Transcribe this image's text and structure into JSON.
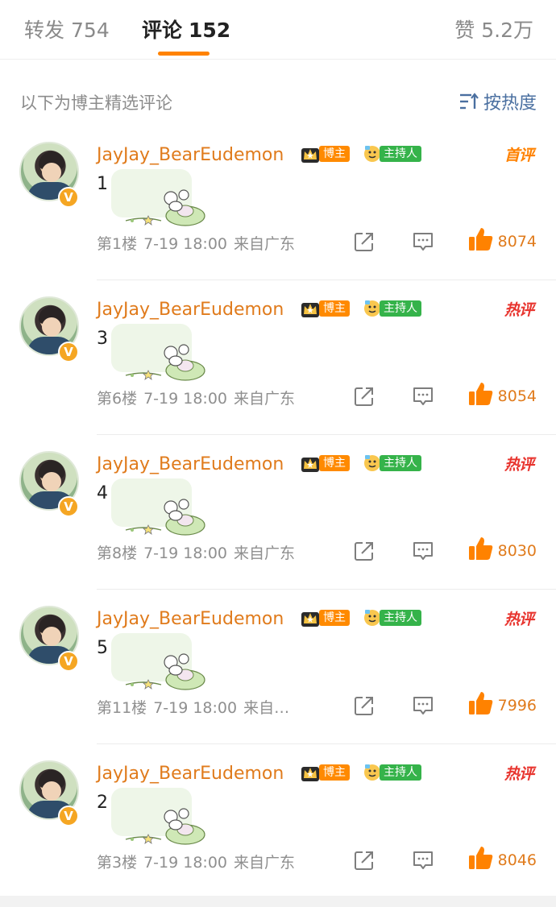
{
  "tabs": {
    "repost": {
      "label": "转发",
      "count": "754"
    },
    "comments": {
      "label": "评论",
      "count": "152"
    },
    "likes": {
      "label": "赞",
      "count": "5.2万"
    }
  },
  "subheader": {
    "note": "以下为博主精选评论",
    "sort_label": "按热度"
  },
  "comments": [
    {
      "username": "JayJay_BearEudemon",
      "blogger_tag": "博主",
      "host_tag": "主持人",
      "hot_tag": "首评",
      "content": "1",
      "floor": "第1楼",
      "time": "7-19 18:00",
      "location": "来自广东",
      "likes": "8074"
    },
    {
      "username": "JayJay_BearEudemon",
      "blogger_tag": "博主",
      "host_tag": "主持人",
      "hot_tag": "热评",
      "content": "3",
      "floor": "第6楼",
      "time": "7-19 18:00",
      "location": "来自广东",
      "likes": "8054"
    },
    {
      "username": "JayJay_BearEudemon",
      "blogger_tag": "博主",
      "host_tag": "主持人",
      "hot_tag": "热评",
      "content": "4",
      "floor": "第8楼",
      "time": "7-19 18:00",
      "location": "来自广东",
      "likes": "8030"
    },
    {
      "username": "JayJay_BearEudemon",
      "blogger_tag": "博主",
      "host_tag": "主持人",
      "hot_tag": "热评",
      "content": "5",
      "floor": "第11楼",
      "time": "7-19 18:00",
      "location": "来自…",
      "likes": "7996"
    },
    {
      "username": "JayJay_BearEudemon",
      "blogger_tag": "博主",
      "host_tag": "主持人",
      "hot_tag": "热评",
      "content": "2",
      "floor": "第3楼",
      "time": "7-19 18:00",
      "location": "来自广东",
      "likes": "8046"
    }
  ],
  "colors": {
    "accent": "#ff8200",
    "username": "#e07b1c",
    "hot": "#e8352f",
    "host_green": "#35b34a",
    "sort_blue": "#4a6fa0"
  },
  "icons": {
    "sort": "sort-icon",
    "share": "share-icon",
    "comment": "comment-icon",
    "like": "thumbs-up-icon",
    "verified": "verified-v-icon",
    "crown": "crown-icon",
    "host": "host-icon"
  }
}
